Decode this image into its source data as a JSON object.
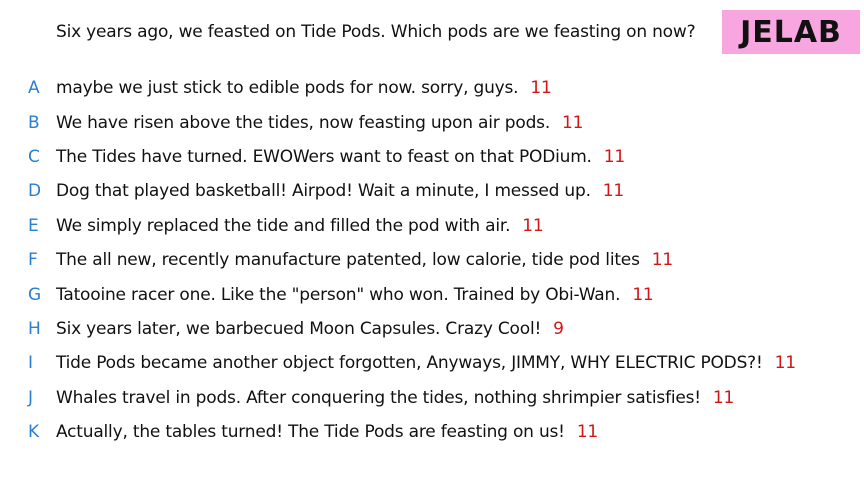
{
  "question": "Six years ago, we feasted on Tide Pods. Which pods are we feasting on now?",
  "badge": "JELAB",
  "colors": {
    "letter": "#2a7fd1",
    "score": "#d01616",
    "badge_bg": "#f7a6df",
    "text": "#111111"
  },
  "answers": [
    {
      "letter": "A",
      "text": "maybe we just stick to edible pods for now. sorry, guys.",
      "score": "11"
    },
    {
      "letter": "B",
      "text": "We have risen above the tides, now feasting upon air pods.",
      "score": "11"
    },
    {
      "letter": "C",
      "text": "The Tides have turned. EWOWers want to feast on that PODium.",
      "score": "11"
    },
    {
      "letter": "D",
      "text": "Dog that played basketball! Airpod! Wait a minute, I messed up.",
      "score": "11"
    },
    {
      "letter": "E",
      "text": "We simply replaced the tide and filled the pod with air.",
      "score": "11"
    },
    {
      "letter": "F",
      "text": "The all new, recently manufacture patented, low calorie, tide pod lites",
      "score": "11"
    },
    {
      "letter": "G",
      "text": "Tatooine racer one. Like the \"person\" who won. Trained by Obi-Wan.",
      "score": "11"
    },
    {
      "letter": "H",
      "text": "Six years later, we barbecued Moon Capsules. Crazy Cool!",
      "score": "9"
    },
    {
      "letter": "I",
      "text": "Tide Pods became another object forgotten, Anyways, JIMMY, WHY ELECTRIC PODS?!",
      "score": "11"
    },
    {
      "letter": "J",
      "text": "Whales travel in pods. After conquering the tides, nothing shrimpier satisfies!",
      "score": "11"
    },
    {
      "letter": "K",
      "text": "Actually, the tables turned! The Tide Pods are feasting on us!",
      "score": "11"
    }
  ]
}
